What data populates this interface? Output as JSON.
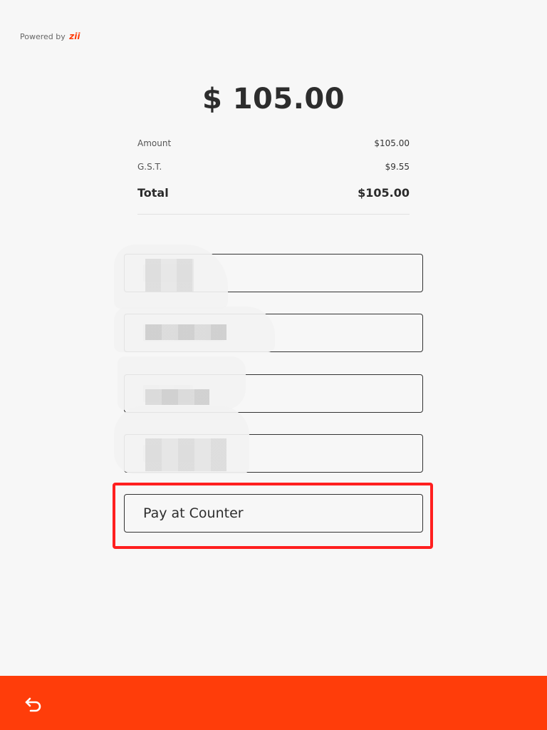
{
  "header": {
    "powered_prefix": "Powered by",
    "brand_name": "zii",
    "brand_color": "#ff3d0a"
  },
  "payment": {
    "display_amount": "$ 105.00",
    "lines": [
      {
        "label": "Amount",
        "value": "$105.00"
      },
      {
        "label": "G.S.T.",
        "value": "$9.55"
      }
    ],
    "total": {
      "label": "Total",
      "value": "$105.00"
    }
  },
  "methods": {
    "pay_at_counter_label": "Pay at Counter",
    "highlight_color": "#ff1f1f"
  },
  "footer": {
    "background_color": "#ff3d0a",
    "back_icon": "undo-arrow-icon"
  }
}
